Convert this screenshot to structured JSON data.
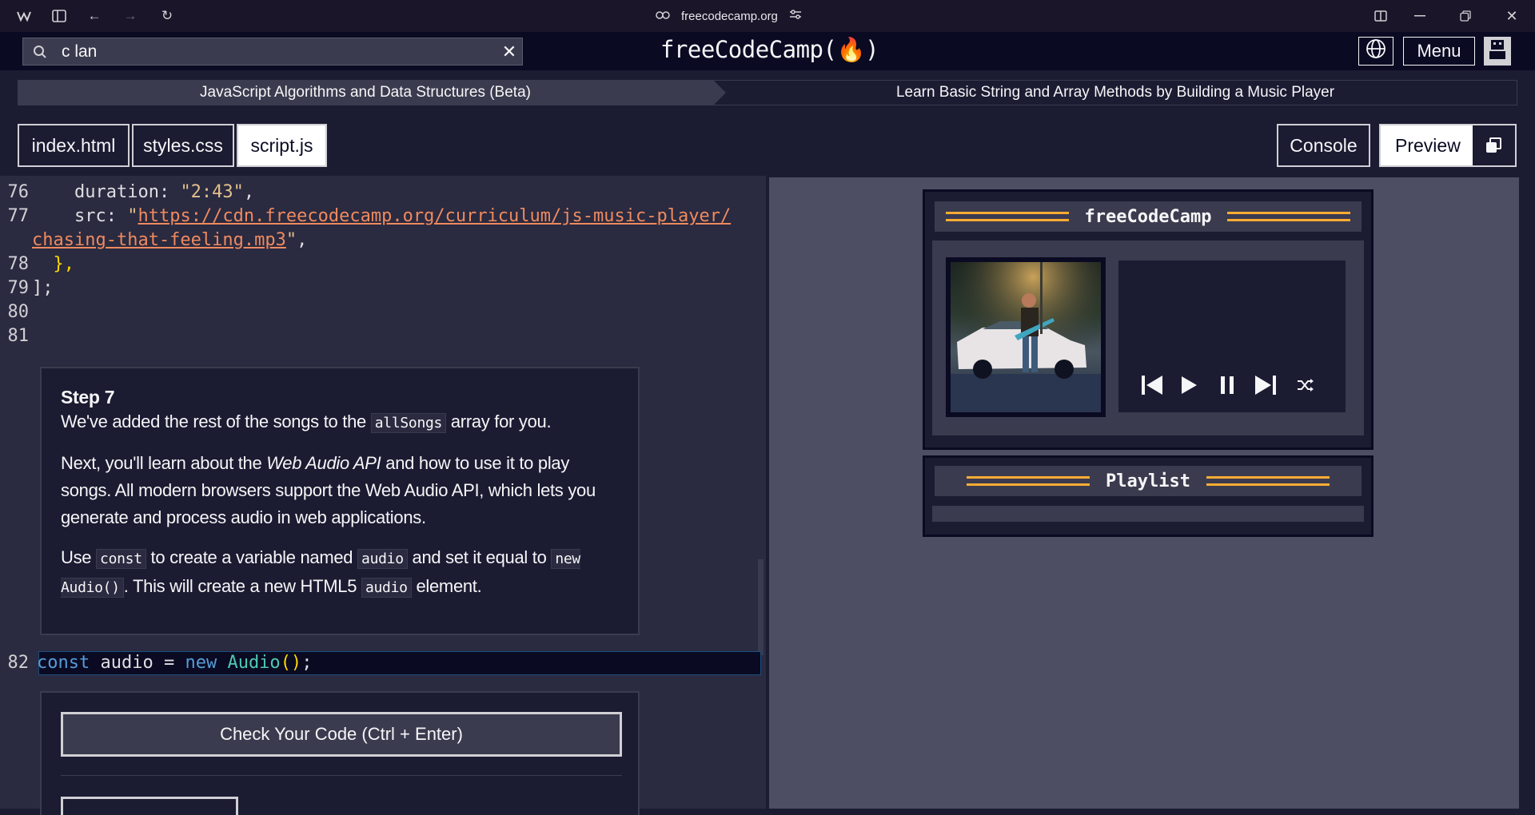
{
  "browser": {
    "url": "freecodecamp.org"
  },
  "nav": {
    "search_value": "c lan",
    "logo": "freeCodeCamp(🔥)",
    "menu_label": "Menu"
  },
  "breadcrumbs": {
    "course": "JavaScript Algorithms and Data Structures (Beta)",
    "project": "Learn Basic String and Array Methods by Building a Music Player"
  },
  "tabs": {
    "index": "index.html",
    "styles": "styles.css",
    "script": "script.js",
    "console": "Console",
    "preview": "Preview"
  },
  "code": {
    "l76_num": "76",
    "l76_key": "    duration: ",
    "l76_val": "\"2:43\"",
    "l76_end": ",",
    "l77_num": "77",
    "l77_key": "    src: ",
    "l77_q1": "\"",
    "l77_url1": "https://cdn.freecodecamp.org/curriculum/js-music-player/",
    "l77_url2": "chasing-that-feeling.mp3",
    "l77_q2": "\"",
    "l77_end": ",",
    "l78_num": "78",
    "l78_text": "  },",
    "l79_num": "79",
    "l79_text": "];",
    "l80_num": "80",
    "l81_num": "81",
    "l82_num": "82",
    "l82_kw": "const",
    "l82_id": " audio = ",
    "l82_new": "new",
    "l82_cls": " Audio",
    "l82_paren": "()",
    "l82_semi": ";"
  },
  "step": {
    "title": "Step 7",
    "p1_a": "We've added the rest of the songs to the ",
    "p1_code": "allSongs",
    "p1_b": " array for you.",
    "p2_a": "Next, you'll learn about the ",
    "p2_em": "Web Audio API",
    "p2_b": " and how to use it to play songs. All modern browsers support the Web Audio API, which lets you generate and process audio in web applications.",
    "p3_a": "Use ",
    "p3_code1": "const",
    "p3_b": " to create a variable named ",
    "p3_code2": "audio",
    "p3_c": " and set it equal to ",
    "p3_code3": "new Audio()",
    "p3_d": ". This will create a new HTML5 ",
    "p3_code4": "audio",
    "p3_e": " element."
  },
  "actions": {
    "check_label": "Check Your Code (Ctrl + Enter)"
  },
  "preview": {
    "player_title": "freeCodeCamp",
    "playlist_title": "Playlist"
  },
  "colors": {
    "accent_yellow": "#feac32",
    "editor_bg": "#2a2a40",
    "preview_bg": "#4d4d64"
  }
}
